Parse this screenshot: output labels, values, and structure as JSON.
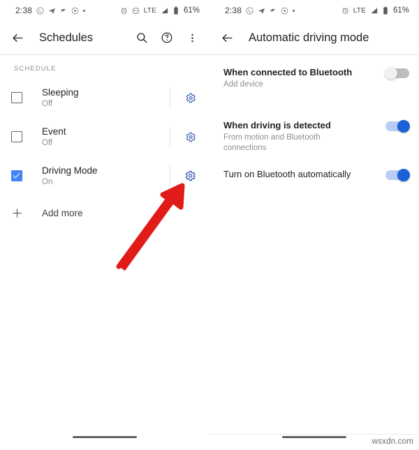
{
  "left_panel": {
    "status_bar": {
      "time": "2:38",
      "notification_icons": [
        "whatsapp-icon",
        "telegram-icon",
        "app-icon",
        "circle-play-icon",
        "dot-icon"
      ],
      "system_icons": [
        "alarm-icon",
        "do-not-disturb-icon"
      ],
      "network": "LTE",
      "battery_percent": "61%"
    },
    "appbar": {
      "back_label": "Back",
      "title": "Schedules",
      "actions": [
        "search-icon",
        "help-icon",
        "overflow-menu-icon"
      ]
    },
    "section_label": "SCHEDULE",
    "schedules": [
      {
        "title": "Sleeping",
        "status": "Off",
        "checked": false,
        "settings_label": "Settings"
      },
      {
        "title": "Event",
        "status": "Off",
        "checked": false,
        "settings_label": "Settings"
      },
      {
        "title": "Driving Mode",
        "status": "On",
        "checked": true,
        "settings_label": "Settings"
      }
    ],
    "add_more": "Add more"
  },
  "right_panel": {
    "status_bar": {
      "time": "2:38",
      "notification_icons": [
        "whatsapp-icon",
        "telegram-icon",
        "app-icon",
        "circle-play-icon",
        "dot-icon"
      ],
      "system_icons": [
        "alarm-icon"
      ],
      "network": "LTE",
      "battery_percent": "61%"
    },
    "appbar": {
      "back_label": "Back",
      "title": "Automatic driving mode"
    },
    "settings": [
      {
        "title": "When connected to Bluetooth",
        "subtitle": "Add device",
        "toggle": "off"
      },
      {
        "title": "When driving is detected",
        "subtitle": "From motion and Bluetooth connections",
        "toggle": "on"
      },
      {
        "title": "Turn on Bluetooth automatically",
        "subtitle": "",
        "toggle": "on"
      }
    ]
  },
  "annotation": {
    "arrow_color": "#e01b18",
    "arrow_target": "driving-mode-settings-gear"
  },
  "watermark": "wsxdn.com",
  "colors": {
    "accent_blue": "#4285f4",
    "gear_blue": "#3f62b4",
    "toggle_on": "#1a62d6",
    "text_primary": "#202124",
    "text_secondary": "#8c8f93"
  }
}
